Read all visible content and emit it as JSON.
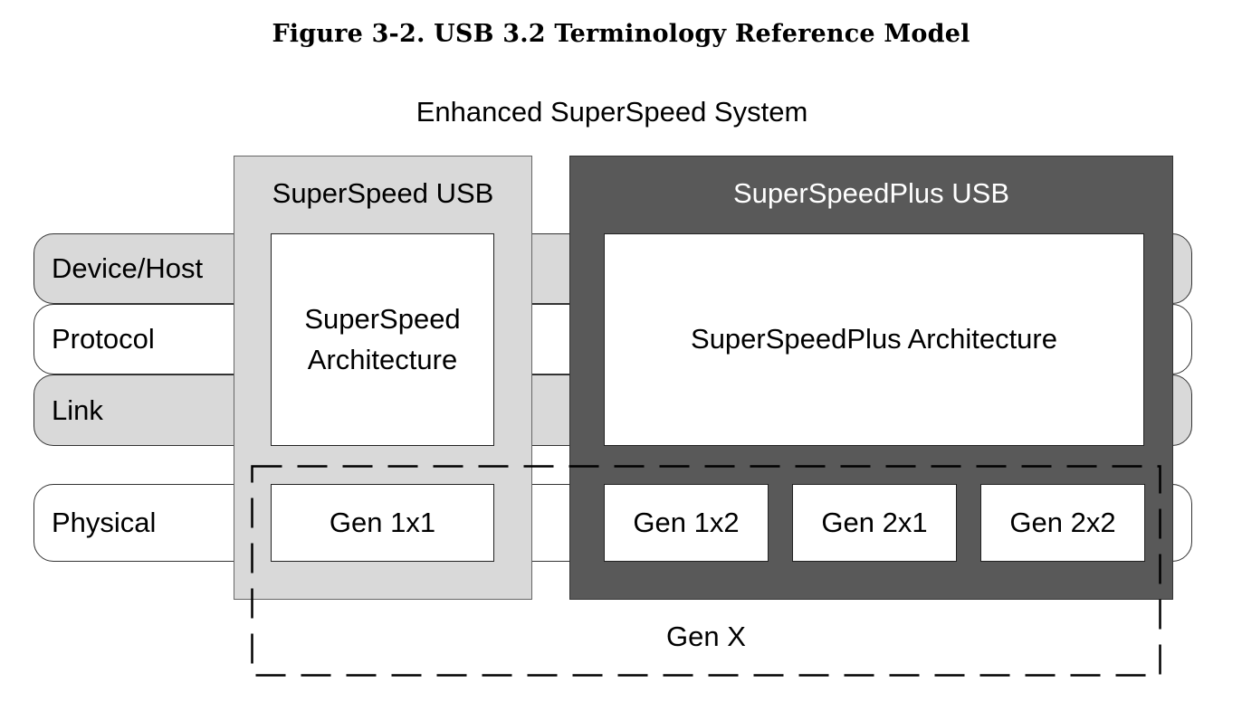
{
  "figure": {
    "title": "Figure 3-2.  USB 3.2 Terminology Reference Model",
    "system_label": "Enhanced SuperSpeed System"
  },
  "layers": [
    {
      "label": "Device/Host",
      "fill": "#d9d9d9"
    },
    {
      "label": "Protocol",
      "fill": "#ffffff"
    },
    {
      "label": "Link",
      "fill": "#d9d9d9"
    },
    {
      "label": "Physical",
      "fill": "#ffffff"
    }
  ],
  "superspeed": {
    "title": "SuperSpeed USB",
    "fill": "#d9d9d9",
    "architecture_line1": "SuperSpeed",
    "architecture_line2": "Architecture",
    "gens": [
      "Gen 1x1"
    ]
  },
  "superspeedplus": {
    "title": "SuperSpeedPlus USB",
    "fill": "#595959",
    "architecture": "SuperSpeedPlus Architecture",
    "gens": [
      "Gen 1x2",
      "Gen 2x1",
      "Gen 2x2"
    ]
  },
  "genx": {
    "label": "Gen X",
    "border_style": "dashed"
  }
}
